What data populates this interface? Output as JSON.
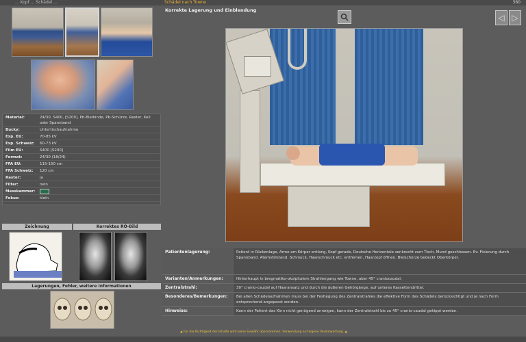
{
  "topbar": {
    "crumb": "... Kopf ... Schädel ...",
    "title": "Schädel nach Towne",
    "num": "360"
  },
  "details": [
    {
      "k": "Material:",
      "v": "24/30, S400, [S200], Pb-Bleibinde, Pb-Schürze, Raster, Keil oder Spannband",
      "tall": true
    },
    {
      "k": "Bucky:",
      "v": "Untertischaufnahme"
    },
    {
      "k": "Exp. EU:",
      "v": "70-85 kV"
    },
    {
      "k": "Exp. Schweiz:",
      "v": "60-73 kV"
    },
    {
      "k": "Film EU:",
      "v": "S400 [S200]"
    },
    {
      "k": "Format:",
      "v": "24/30 (18/24)"
    },
    {
      "k": "FFA EU:",
      "v": "115-150 cm"
    },
    {
      "k": "FFA Schweiz:",
      "v": "120 cm"
    },
    {
      "k": "Raster:",
      "v": "ja"
    },
    {
      "k": "Filter:",
      "v": "nein"
    },
    {
      "k": "Messkammer:",
      "v": ""
    },
    {
      "k": "Fokus:",
      "v": "klein"
    }
  ],
  "left_headers": {
    "zeichnung": "Zeichnung",
    "korrekt": "Korrektes RÖ-Bild",
    "lagerung": "Lagerungen, Fehler, weitere Informationen"
  },
  "main": {
    "title": "Korrekte Lagerung und Einblendung",
    "prev_glyph": "◁",
    "next_glyph": "▷"
  },
  "info": [
    {
      "k": "Patientenlagerung:",
      "v": "Patient in Rückenlage, Arme am Körper entlang, Kopf gerade, Deutsche Horizontale senkrecht zum Tisch, Mund geschlossen. Ev. Fixierung durch Spannband. Atemstillstand. Schmuck, Haarschmuck etc. entfernen, Haarzopf öffnen. Bleischürze bedeckt Oberkörper."
    },
    {
      "k": "Varianten/Anmerkungen:",
      "v": "Hinterhaupt in bregmatiko-okzipitalem Strahlengang wie Towne, aber 45° craniocaudal."
    },
    {
      "k": "Zentralstrahl:",
      "v": "30° cranio-caudal auf Haaransatz und durch die äußeren Gehörgänge, auf unteres Kassettendrittel."
    },
    {
      "k": "Besonderes/Bemerkungen:",
      "v": "Bei allen Schädelaufnahmen muss bei der Festlegung des Zentralstrahles die effektive Form des Schädels berücksichtigt und je nach Form entsprechend angepasst werden."
    },
    {
      "k": "Hinweise:",
      "v": "Kann der Patient das Kinn nicht genügend anneigen, kann der Zentralstrahl bis zu 45° cranio-caudal gekippt werden."
    }
  ],
  "footer": "▲ Für die Richtigkeit der Inhalte wird keine Gewähr übernommen. Verwendung auf eigene Verantwortung. ▲"
}
